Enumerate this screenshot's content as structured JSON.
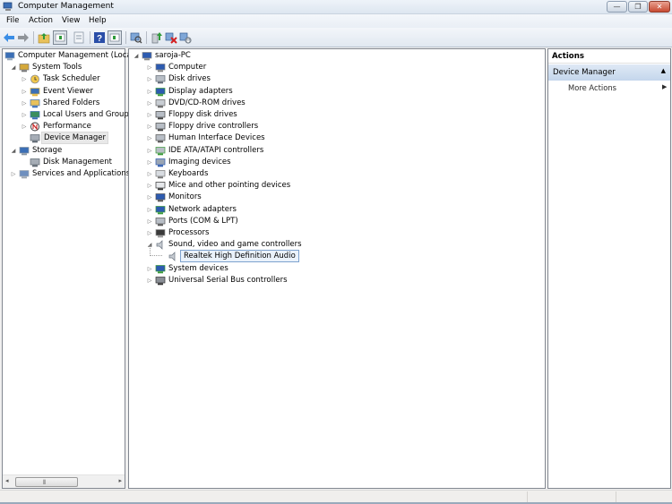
{
  "window": {
    "title": "Computer Management",
    "controls": {
      "minimize": "—",
      "restore": "❐",
      "close": "✕"
    }
  },
  "menu": [
    "File",
    "Action",
    "View",
    "Help"
  ],
  "toolbar": {
    "buttons": [
      "back-icon",
      "forward-icon",
      "up-folder-icon",
      "show-hide-console-tree-icon",
      "properties-icon",
      "help-icon",
      "show-hide-action-pane-icon",
      "scan-hardware-icon",
      "update-driver-icon",
      "uninstall-icon",
      "enable-device-icon"
    ]
  },
  "left_tree": [
    {
      "label": "Computer Management (Local",
      "level": 0,
      "expander": "",
      "icon": "computer-management-icon"
    },
    {
      "label": "System Tools",
      "level": 1,
      "expander": "◢",
      "icon": "tools-icon"
    },
    {
      "label": "Task Scheduler",
      "level": 2,
      "expander": "▷",
      "icon": "clock-icon"
    },
    {
      "label": "Event Viewer",
      "level": 2,
      "expander": "▷",
      "icon": "event-viewer-icon"
    },
    {
      "label": "Shared Folders",
      "level": 2,
      "expander": "▷",
      "icon": "shared-folder-icon"
    },
    {
      "label": "Local Users and Groups",
      "level": 2,
      "expander": "▷",
      "icon": "users-icon"
    },
    {
      "label": "Performance",
      "level": 2,
      "expander": "▷",
      "icon": "performance-icon"
    },
    {
      "label": "Device Manager",
      "level": 2,
      "expander": "",
      "icon": "device-manager-icon",
      "selected": true
    },
    {
      "label": "Storage",
      "level": 1,
      "expander": "◢",
      "icon": "storage-icon"
    },
    {
      "label": "Disk Management",
      "level": 2,
      "expander": "",
      "icon": "disk-management-icon"
    },
    {
      "label": "Services and Applications",
      "level": 1,
      "expander": "▷",
      "icon": "services-icon"
    }
  ],
  "device_tree": {
    "root": "saroja-PC",
    "categories": [
      {
        "label": "Computer",
        "icon": "computer-icon"
      },
      {
        "label": "Disk drives",
        "icon": "disk-drive-icon"
      },
      {
        "label": "Display adapters",
        "icon": "display-adapter-icon"
      },
      {
        "label": "DVD/CD-ROM drives",
        "icon": "dvd-icon"
      },
      {
        "label": "Floppy disk drives",
        "icon": "floppy-icon"
      },
      {
        "label": "Floppy drive controllers",
        "icon": "floppy-controller-icon"
      },
      {
        "label": "Human Interface Devices",
        "icon": "hid-icon"
      },
      {
        "label": "IDE ATA/ATAPI controllers",
        "icon": "ide-icon"
      },
      {
        "label": "Imaging devices",
        "icon": "imaging-icon"
      },
      {
        "label": "Keyboards",
        "icon": "keyboard-icon"
      },
      {
        "label": "Mice and other pointing devices",
        "icon": "mouse-icon"
      },
      {
        "label": "Monitors",
        "icon": "monitor-icon"
      },
      {
        "label": "Network adapters",
        "icon": "network-icon"
      },
      {
        "label": "Ports (COM & LPT)",
        "icon": "port-icon"
      },
      {
        "label": "Processors",
        "icon": "processor-icon"
      },
      {
        "label": "Sound, video and game controllers",
        "icon": "speaker-icon",
        "expanded": true,
        "children": [
          {
            "label": "Realtek High Definition Audio",
            "icon": "speaker-icon",
            "selected": true
          }
        ]
      },
      {
        "label": "System devices",
        "icon": "system-device-icon"
      },
      {
        "label": "Universal Serial Bus controllers",
        "icon": "usb-icon"
      }
    ]
  },
  "actions": {
    "header": "Actions",
    "section": "Device Manager",
    "items": [
      "More Actions"
    ]
  },
  "colors": {
    "selection_border": "#7da2ce",
    "action_section_bg": "#c4d6ec",
    "close_button": "#c74a32"
  }
}
